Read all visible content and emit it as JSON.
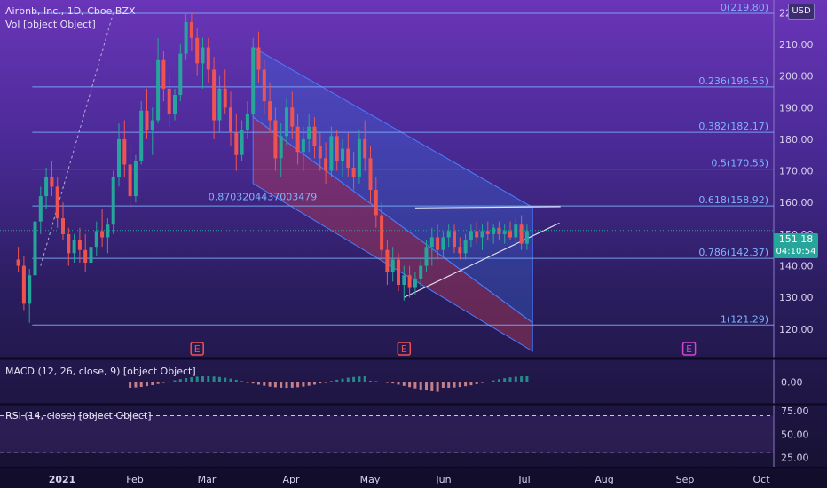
{
  "header": {
    "title": "Airbnb, Inc., 1D, Cboe BZX",
    "vol": "Vol [object Object]",
    "macd": "MACD (12, 26, close, 9) [object Object]",
    "rsi": "RSI (14, close) [object Object]",
    "currency": "USD"
  },
  "price_badge": {
    "price": "151.18",
    "timer": "04:10:54",
    "color": "#26a69a"
  },
  "colors": {
    "up": "#26a69a",
    "down": "#ef5350",
    "fib": "#7fb3ff",
    "channel_up": "#3a6de0",
    "channel_down": "#b03a55",
    "earnings": "#ef5350",
    "earnings_future": "#d046d0"
  },
  "chart_data": {
    "type": "candlestick",
    "title": "Airbnb, Inc., 1D, Cboe BZX",
    "ylim": [
      111,
      224
    ],
    "y_ticks": [
      120,
      130,
      140,
      150,
      160,
      170,
      180,
      190,
      200,
      210,
      220
    ],
    "x_ticks": [
      "2021",
      "Feb",
      "Mar",
      "Apr",
      "May",
      "Jun",
      "Jul",
      "Aug",
      "Sep",
      "Oct"
    ],
    "fib_levels": [
      {
        "label": "0(219.80)",
        "value": 219.8
      },
      {
        "label": "0.236(196.55)",
        "value": 196.55
      },
      {
        "label": "0.382(182.17)",
        "value": 182.17
      },
      {
        "label": "0.5(170.55)",
        "value": 170.55
      },
      {
        "label": "0.618(158.92)",
        "value": 158.92
      },
      {
        "label": "0.786(142.37)",
        "value": 142.37
      },
      {
        "label": "1(121.29)",
        "value": 121.29
      }
    ],
    "annotation": "0.8703204437003479",
    "earnings": [
      "E",
      "E",
      "E"
    ],
    "candles": [
      [
        2,
        142,
        146,
        138,
        140
      ],
      [
        3,
        140,
        143,
        126,
        128
      ],
      [
        4,
        128,
        139,
        122,
        137
      ],
      [
        5,
        137,
        156,
        135,
        154
      ],
      [
        6,
        154,
        165,
        150,
        162
      ],
      [
        7,
        162,
        171,
        158,
        168
      ],
      [
        8,
        168,
        173,
        162,
        165
      ],
      [
        9,
        165,
        168,
        152,
        155
      ],
      [
        10,
        155,
        160,
        148,
        150
      ],
      [
        11,
        150,
        152,
        140,
        144
      ],
      [
        12,
        144,
        150,
        141,
        148
      ],
      [
        13,
        148,
        152,
        141,
        145
      ],
      [
        14,
        145,
        150,
        138,
        141
      ],
      [
        15,
        141,
        148,
        139,
        146
      ],
      [
        16,
        146,
        154,
        143,
        151
      ],
      [
        17,
        151,
        158,
        146,
        149
      ],
      [
        18,
        149,
        155,
        144,
        153
      ],
      [
        19,
        153,
        170,
        150,
        168
      ],
      [
        20,
        168,
        185,
        165,
        180
      ],
      [
        21,
        180,
        186,
        168,
        172
      ],
      [
        22,
        172,
        178,
        158,
        162
      ],
      [
        23,
        162,
        175,
        160,
        173
      ],
      [
        24,
        173,
        192,
        172,
        189
      ],
      [
        25,
        189,
        196,
        180,
        183
      ],
      [
        26,
        183,
        190,
        175,
        186
      ],
      [
        27,
        186,
        212,
        185,
        205
      ],
      [
        28,
        205,
        208,
        192,
        196
      ],
      [
        29,
        196,
        200,
        184,
        188
      ],
      [
        30,
        188,
        196,
        186,
        194
      ],
      [
        31,
        194,
        210,
        192,
        207
      ],
      [
        32,
        207,
        220,
        205,
        217
      ],
      [
        33,
        217,
        220,
        208,
        212
      ],
      [
        34,
        212,
        215,
        200,
        204
      ],
      [
        35,
        204,
        212,
        196,
        209
      ],
      [
        36,
        209,
        212,
        198,
        202
      ],
      [
        37,
        202,
        206,
        180,
        186
      ],
      [
        38,
        186,
        200,
        182,
        196
      ],
      [
        39,
        196,
        202,
        188,
        190
      ],
      [
        40,
        190,
        195,
        178,
        182
      ],
      [
        41,
        182,
        188,
        170,
        175
      ],
      [
        42,
        175,
        186,
        173,
        183
      ],
      [
        43,
        183,
        192,
        180,
        188
      ],
      [
        44,
        188,
        212,
        187,
        209
      ],
      [
        45,
        209,
        214,
        198,
        202
      ],
      [
        46,
        202,
        205,
        188,
        192
      ],
      [
        47,
        192,
        198,
        182,
        186
      ],
      [
        48,
        186,
        190,
        170,
        174
      ],
      [
        49,
        174,
        185,
        168,
        181
      ],
      [
        50,
        181,
        193,
        178,
        190
      ],
      [
        51,
        190,
        195,
        180,
        184
      ],
      [
        52,
        184,
        188,
        172,
        176
      ],
      [
        53,
        176,
        184,
        170,
        180
      ],
      [
        54,
        180,
        188,
        176,
        184
      ],
      [
        55,
        184,
        187,
        174,
        178
      ],
      [
        56,
        178,
        182,
        170,
        174
      ],
      [
        57,
        174,
        179,
        166,
        170
      ],
      [
        58,
        170,
        184,
        168,
        181
      ],
      [
        59,
        181,
        183,
        170,
        173
      ],
      [
        60,
        173,
        180,
        168,
        177
      ],
      [
        61,
        177,
        182,
        168,
        171
      ],
      [
        62,
        171,
        176,
        164,
        168
      ],
      [
        63,
        168,
        183,
        166,
        180
      ],
      [
        64,
        180,
        186,
        170,
        174
      ],
      [
        65,
        174,
        178,
        160,
        164
      ],
      [
        66,
        164,
        168,
        152,
        156
      ],
      [
        67,
        156,
        160,
        142,
        145
      ],
      [
        68,
        145,
        148,
        134,
        138
      ],
      [
        69,
        138,
        146,
        135,
        142
      ],
      [
        70,
        142,
        144,
        132,
        134
      ],
      [
        71,
        134,
        140,
        129,
        137
      ],
      [
        72,
        137,
        140,
        130,
        133
      ],
      [
        73,
        133,
        138,
        131,
        136
      ],
      [
        74,
        136,
        142,
        133,
        140
      ],
      [
        75,
        140,
        148,
        138,
        146
      ],
      [
        76,
        146,
        152,
        140,
        149
      ],
      [
        77,
        149,
        153,
        142,
        145
      ],
      [
        78,
        145,
        151,
        143,
        149
      ],
      [
        79,
        149,
        153,
        146,
        151
      ],
      [
        80,
        151,
        153,
        144,
        146
      ],
      [
        81,
        146,
        149,
        142,
        144
      ],
      [
        82,
        144,
        150,
        142,
        148
      ],
      [
        83,
        148,
        153,
        146,
        151
      ],
      [
        84,
        151,
        154,
        147,
        149
      ],
      [
        85,
        149,
        153,
        145,
        151
      ],
      [
        86,
        151,
        154,
        148,
        150
      ],
      [
        87,
        150,
        153,
        147,
        152
      ],
      [
        88,
        152,
        154,
        148,
        150
      ],
      [
        89,
        150,
        153,
        147,
        151
      ],
      [
        90,
        151,
        154,
        148,
        149
      ],
      [
        91,
        149,
        155,
        146,
        153
      ],
      [
        92,
        153,
        156,
        145,
        147
      ],
      [
        93,
        147,
        153,
        145,
        151
      ]
    ],
    "macd": {
      "ylim": [
        -1.5,
        1.5
      ],
      "y_ticks": [
        0.0
      ],
      "y_tick_labels": [
        "0.00"
      ]
    },
    "rsi": {
      "ylim": [
        15,
        80
      ],
      "y_ticks": [
        25,
        50,
        75
      ],
      "y_tick_labels": [
        "25.00",
        "50.00",
        "75.00"
      ]
    },
    "grid": false,
    "legend": "none"
  }
}
